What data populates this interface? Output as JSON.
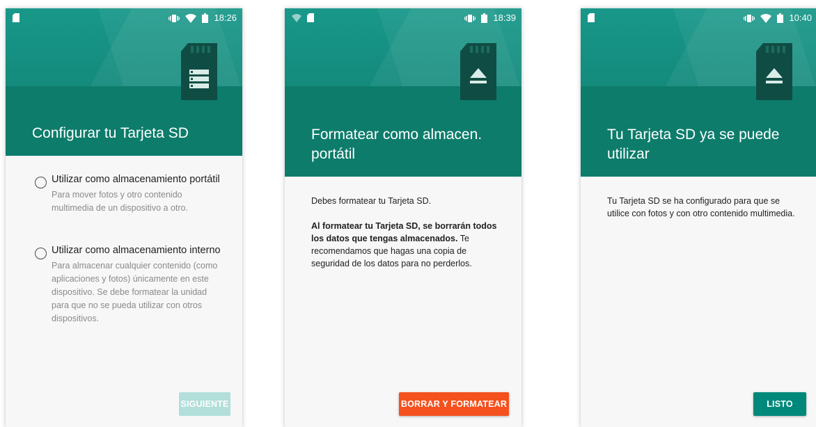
{
  "colors": {
    "header": "#0d7c6b",
    "header_top": "#19988a",
    "button_disabled": "#b2dfda",
    "button_danger": "#f4511e",
    "button_primary": "#00897b"
  },
  "screens": [
    {
      "status": {
        "time": "18:26"
      },
      "title": "Configurar tu Tarjeta SD",
      "icon": "sd-card-storage-icon",
      "options": [
        {
          "title": "Utilizar como almacenamiento portátil",
          "description": "Para mover fotos y otro contenido multimedia de un dispositivo a otro."
        },
        {
          "title": "Utilizar como almacenamiento interno",
          "description": "Para almacenar cualquier contenido (como aplicaciones y fotos) únicamente en este dispositivo. Se debe formatear la unidad para que no se pueda utilizar con otros dispositivos."
        }
      ],
      "button": "SIGUIENTE"
    },
    {
      "status": {
        "time": "18:39"
      },
      "title": "Formatear como almacen. portátil",
      "icon": "sd-card-eject-icon",
      "paragraph1": "Debes formatear tu Tarjeta SD.",
      "warning_bold": "Al formatear tu Tarjeta SD, se borrarán todos los datos que tengas almacenados.",
      "warning_rest": "Te recomendamos que hagas una copia de seguridad de los datos para no perderlos.",
      "button": "BORRAR Y FORMATEAR"
    },
    {
      "status": {
        "time": "10:40"
      },
      "title": "Tu Tarjeta SD ya se puede utilizar",
      "icon": "sd-card-eject-icon",
      "paragraph1": "Tu Tarjeta SD se ha configurado para que se utilice con fotos y con otro contenido multimedia.",
      "button": "LISTO"
    }
  ]
}
